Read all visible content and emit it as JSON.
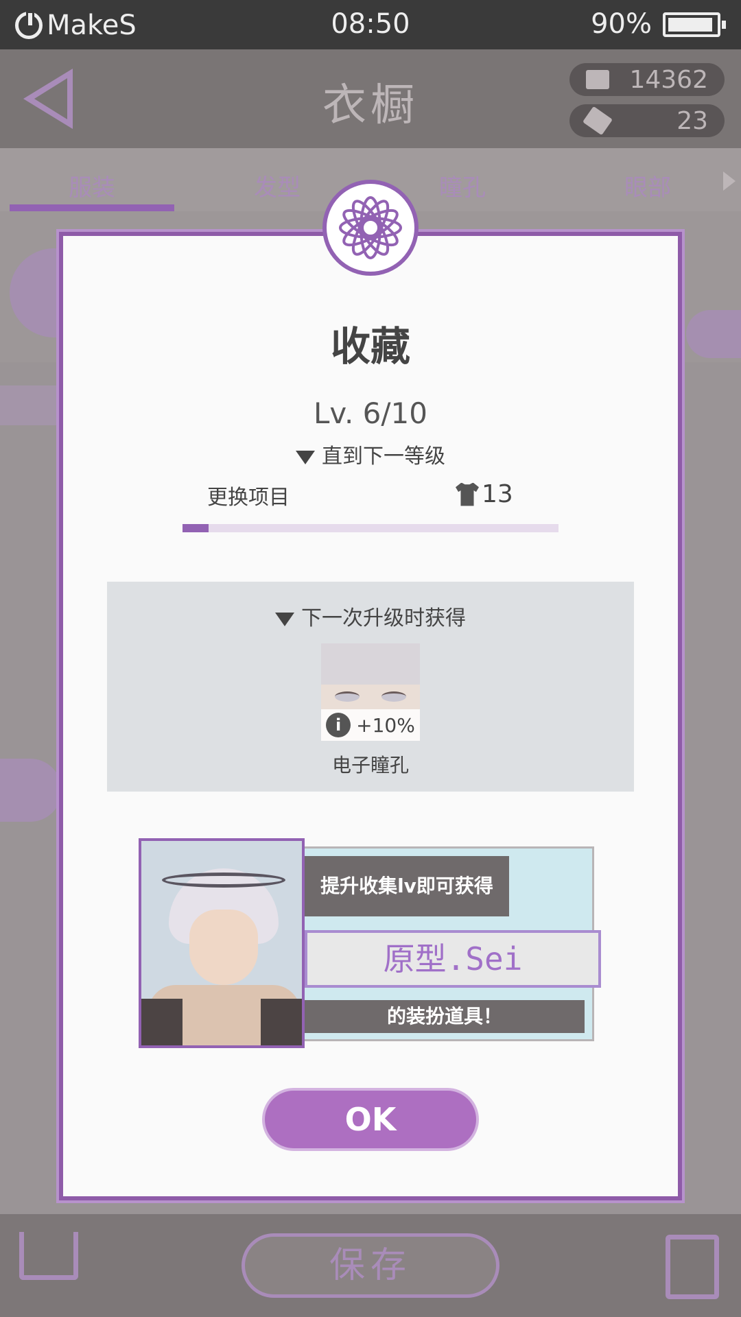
{
  "status_bar": {
    "brand": "MakeS",
    "time": "08:50",
    "battery": "90%"
  },
  "header": {
    "title": "衣橱",
    "currency_1": "14362",
    "currency_2": "23"
  },
  "tabs": [
    {
      "label": "服装"
    },
    {
      "label": "发型"
    },
    {
      "label": "瞳孔"
    },
    {
      "label": "眼部"
    }
  ],
  "dialog": {
    "title": "收藏",
    "level": "Lv. 6/10",
    "next_level_label": "直到下一等级",
    "change_label": "更换项目",
    "change_count": "13",
    "progress": 0.07,
    "reward_header": "下一次升级时获得",
    "reward_bonus": "+10%",
    "reward_name": "电子瞳孔",
    "banner_msg1": "提升收集lv即可获得",
    "banner_name": "原型.Sei",
    "banner_msg2": "的装扮道具！",
    "ok_label": "OK"
  },
  "bottom": {
    "save_label": "保存"
  }
}
